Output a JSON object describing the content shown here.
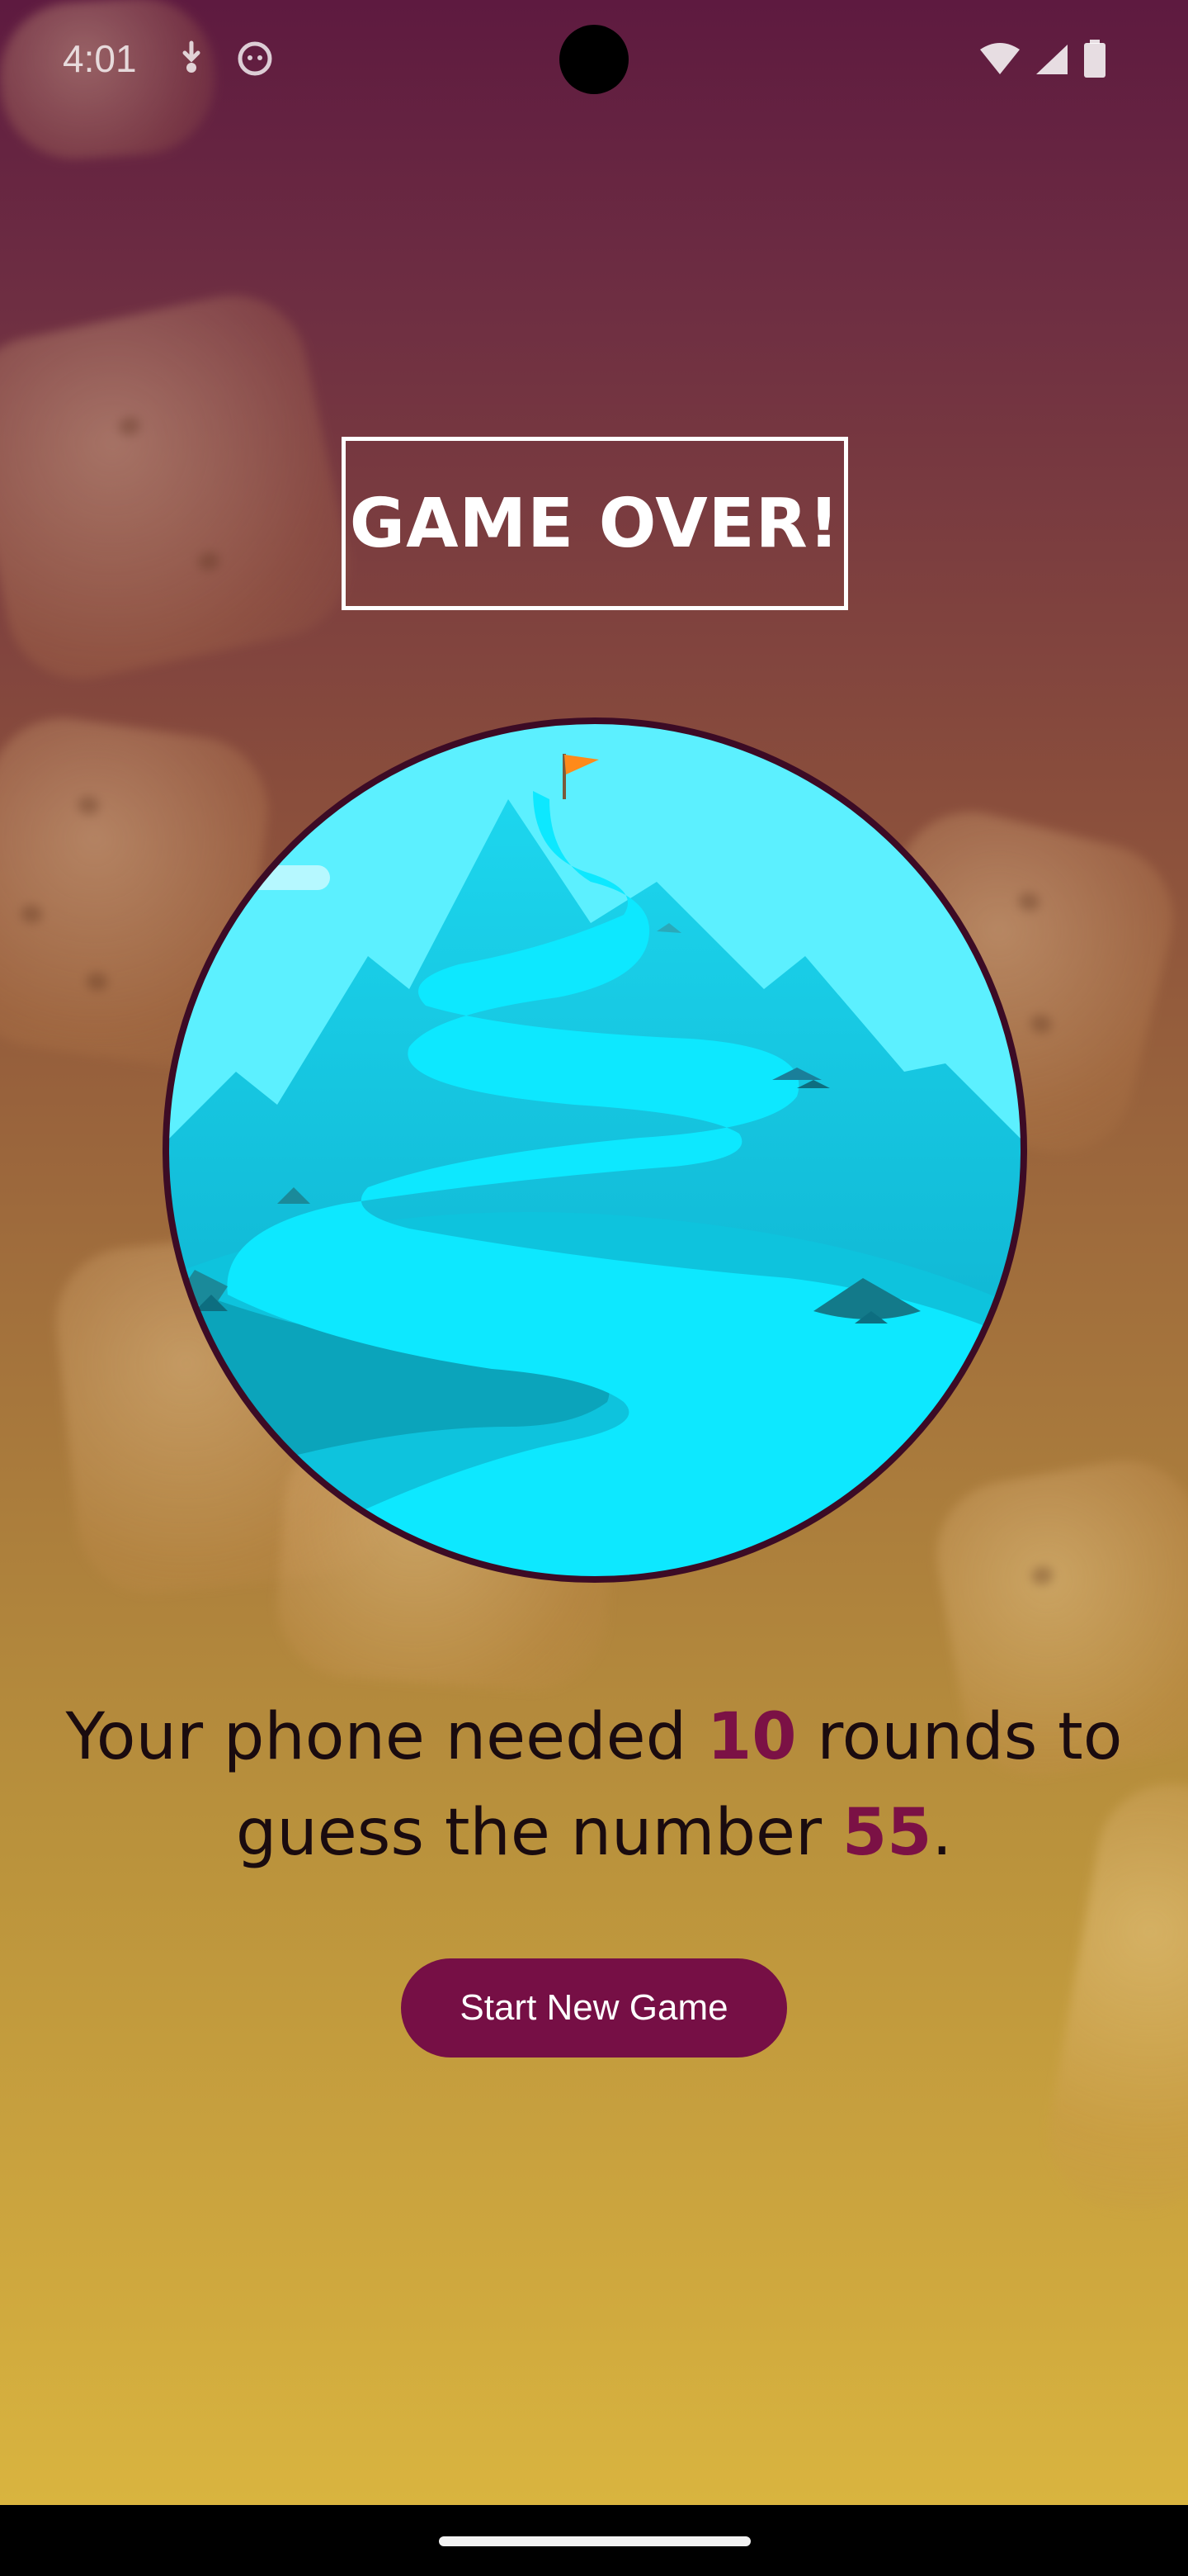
{
  "status_bar": {
    "time": "4:01"
  },
  "title": "GAME OVER!",
  "summary": {
    "part1": "Your phone needed ",
    "rounds": "10",
    "part2": " rounds to guess the number ",
    "number": "55",
    "part3": "."
  },
  "start_button_label": "Start New Game",
  "colors": {
    "accent": "#7b1145",
    "button": "#760f45"
  }
}
